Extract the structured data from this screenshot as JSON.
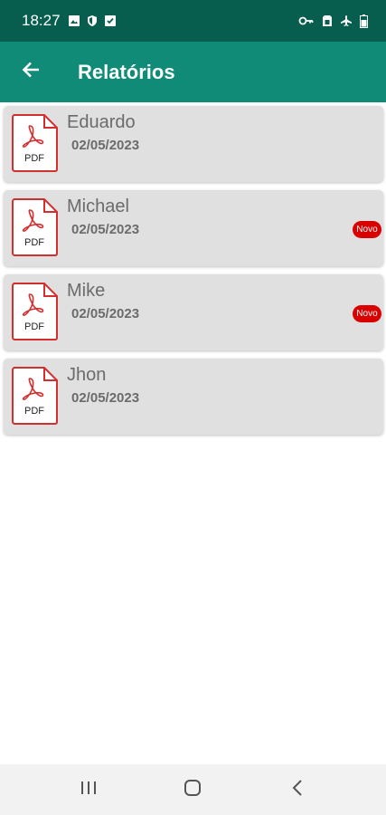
{
  "status_bar": {
    "time": "18:27",
    "left_icons": [
      "image-icon",
      "shield-icon",
      "check-box-icon"
    ],
    "right_icons": [
      "key-icon",
      "sim-icon",
      "airplane-icon",
      "battery-icon"
    ]
  },
  "app_bar": {
    "title": "Relatórios",
    "back_icon": "arrow-left-icon",
    "background": "#0f8b77"
  },
  "reports": [
    {
      "name": "Eduardo",
      "date": "02/05/2023",
      "icon_label": "PDF",
      "is_new": false,
      "badge": ""
    },
    {
      "name": "Michael",
      "date": "02/05/2023",
      "icon_label": "PDF",
      "is_new": true,
      "badge": "Novo"
    },
    {
      "name": "Mike",
      "date": "02/05/2023",
      "icon_label": "PDF",
      "is_new": true,
      "badge": "Novo"
    },
    {
      "name": "Jhon",
      "date": "02/05/2023",
      "icon_label": "PDF",
      "is_new": false,
      "badge": ""
    }
  ],
  "nav_bar": {
    "buttons": [
      "recent-apps-icon",
      "home-icon",
      "back-icon"
    ]
  },
  "colors": {
    "status_bar": "#075e4f",
    "card": "#e0e0e0",
    "pdf_red": "#d32f2f",
    "badge": "#d90000"
  }
}
